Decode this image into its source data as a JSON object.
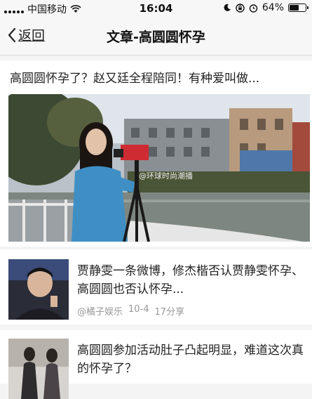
{
  "status_bar": {
    "carrier": "中国移动",
    "time": "16:04",
    "battery": "64%",
    "battery_level": 0.64
  },
  "nav": {
    "back_label": "返回",
    "title": "文章-高圆圆怀孕"
  },
  "featured": {
    "headline": "高圆圆怀孕了？赵又廷全程陪同！有种爱叫做...",
    "image_watermark": "@环球时尚潮播"
  },
  "articles": [
    {
      "title": "贾静雯一条微博，修杰楷否认贾静雯怀孕、高圆圆也否认怀孕...",
      "source": "@橘子娱乐",
      "date": "10-4",
      "shares": "17分享"
    },
    {
      "title": "高圆圆参加活动肚子凸起明显，难道这次真的怀孕了？"
    }
  ]
}
